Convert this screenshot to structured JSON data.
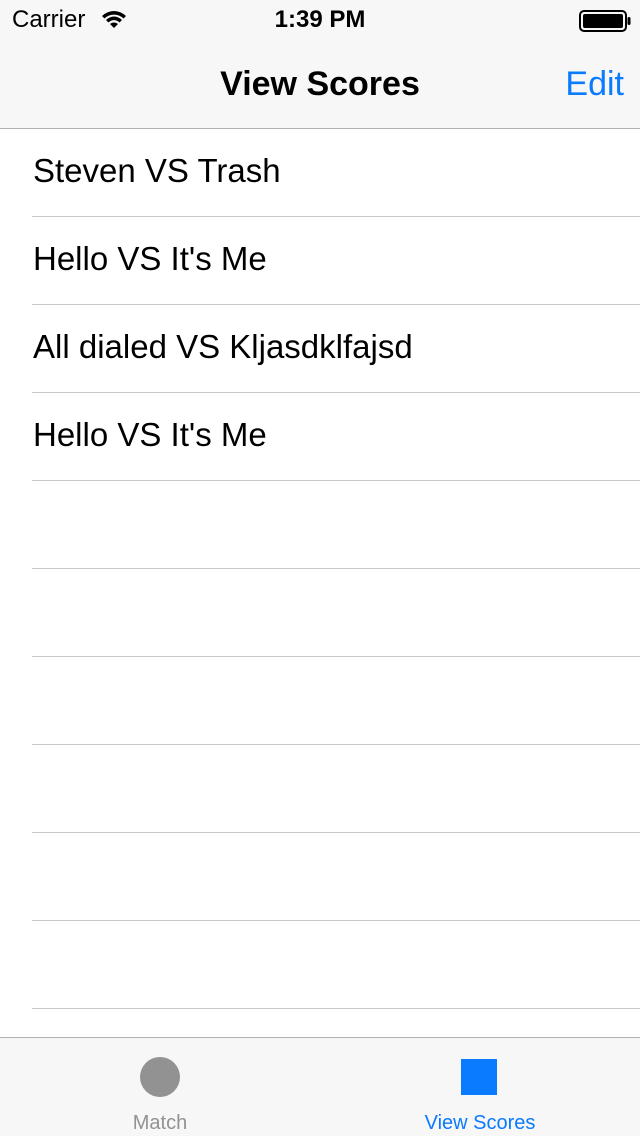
{
  "status_bar": {
    "carrier": "Carrier",
    "time": "1:39 PM",
    "wifi_icon": "wifi-icon",
    "battery_icon": "battery-full-icon"
  },
  "nav_bar": {
    "title": "View Scores",
    "edit_label": "Edit"
  },
  "table": {
    "rows": [
      {
        "label": "Steven VS Trash"
      },
      {
        "label": "Hello VS It's Me"
      },
      {
        "label": "All dialed VS Kljasdklfajsd"
      },
      {
        "label": "Hello VS It's Me"
      },
      {
        "label": ""
      },
      {
        "label": ""
      },
      {
        "label": ""
      },
      {
        "label": ""
      },
      {
        "label": ""
      },
      {
        "label": ""
      },
      {
        "label": ""
      }
    ]
  },
  "tab_bar": {
    "tabs": [
      {
        "label": "Match",
        "icon": "circle-icon",
        "selected": false
      },
      {
        "label": "View Scores",
        "icon": "square-icon",
        "selected": true
      }
    ]
  },
  "colors": {
    "accent": "#0a7aff",
    "inactive": "#929292",
    "bar_background": "#f7f7f7",
    "separator": "#c8c7cc"
  }
}
